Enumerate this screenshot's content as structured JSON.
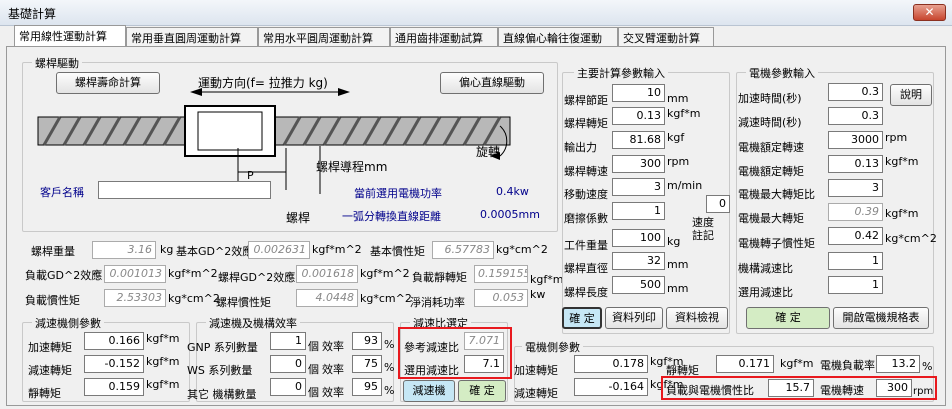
{
  "window": {
    "title": "基礎計算",
    "close": "✕"
  },
  "tabs": [
    "常用線性運動計算",
    "常用垂直圓周運動計算",
    "常用水平圓周運動計算",
    "通用齒排運動試算",
    "直線偏心輪往復運動",
    "交叉臂運動計算"
  ],
  "screw": {
    "group": "螺桿驅動",
    "life_btn": "螺桿壽命計算",
    "eccentric_btn": "偏心直線驅動",
    "direction": "運動方向(f=  拉推力 kg)",
    "pitch_lbl": "螺桿導程mm",
    "p": "P",
    "screw_lbl": "螺桿",
    "rotate_lbl": "旋轉",
    "customer_lbl": "客戶名稱",
    "motor_power_lbl": "當前選用電機功率",
    "motor_power_val": "0.4kw",
    "one_rev_lbl": "一弧分轉換直線距離",
    "one_rev_val": "0.0005mm"
  },
  "props": [
    {
      "l": "螺桿重量",
      "v": "3.16",
      "u": "kg"
    },
    {
      "l": "基本GD^2效應",
      "v": "0.002631",
      "u": "kgf*m^2"
    },
    {
      "l": "基本慣性矩",
      "v": "6.57783",
      "u": "kg*cm^2"
    },
    {
      "l": "負載GD^2效應",
      "v": "0.001013",
      "u": "kgf*m^2"
    },
    {
      "l": "螺桿GD^2效應",
      "v": "0.001618",
      "u": "kgf*m^2"
    },
    {
      "l": "負載靜轉矩",
      "v": "0.159155",
      "u": "kgf*m"
    },
    {
      "l": "負載慣性矩",
      "v": "2.53303",
      "u": "kg*cm^2"
    },
    {
      "l": "螺桿慣性矩",
      "v": "4.0448",
      "u": "kg*cm^2"
    },
    {
      "l": "淨消耗功率",
      "v": "0.053",
      "u": "kw"
    }
  ],
  "main": {
    "group": "主要計算參數輸入",
    "rows": [
      {
        "l": "螺桿節距",
        "v": "10",
        "u": "mm"
      },
      {
        "l": "螺桿轉矩",
        "v": "0.13",
        "u": "kgf*m"
      },
      {
        "l": "輸出力",
        "v": "81.68",
        "u": "kgf"
      },
      {
        "l": "螺桿轉速",
        "v": "300",
        "u": "rpm"
      },
      {
        "l": "移動速度",
        "v": "3",
        "u": "m/min"
      },
      {
        "l": "磨擦係數",
        "v": "1",
        "u": ""
      },
      {
        "l": "工件重量",
        "v": "100",
        "u": "kg"
      },
      {
        "l": "螺桿直徑",
        "v": "32",
        "u": "mm"
      },
      {
        "l": "螺桿長度",
        "v": "500",
        "u": "mm"
      }
    ],
    "speed_v": "0",
    "speed_lbl": "速度註記",
    "confirm": "確 定",
    "print": "資料列印",
    "check": "資料檢視"
  },
  "motor": {
    "group": "電機參數輸入",
    "rows": [
      {
        "l": "加速時間(秒)",
        "v": "0.3",
        "u": ""
      },
      {
        "l": "減速時間(秒)",
        "v": "0.3",
        "u": ""
      },
      {
        "l": "電機額定轉速",
        "v": "3000",
        "u": "rpm"
      },
      {
        "l": "電機額定轉矩",
        "v": "0.13",
        "u": "kgf*m"
      },
      {
        "l": "電機最大轉矩比",
        "v": "3",
        "u": ""
      },
      {
        "l": "電機最大轉矩",
        "v": "0.39",
        "u": "kgf*m"
      },
      {
        "l": "電機轉子慣性矩",
        "v": "0.42",
        "u": "kg*cm^2"
      },
      {
        "l": "機構減速比",
        "v": "1",
        "u": ""
      },
      {
        "l": "選用減速比",
        "v": "1",
        "u": ""
      }
    ],
    "explain": "說明",
    "confirm": "確 定",
    "open": "開啟電機規格表"
  },
  "reducer_side": {
    "group": "減速機側參數",
    "rows": [
      {
        "l": "加速轉矩",
        "v": "0.166",
        "u": "kgf*m"
      },
      {
        "l": "減速轉矩",
        "v": "-0.152",
        "u": "kgf*m"
      },
      {
        "l": "靜轉矩",
        "v": "0.159",
        "u": "kgf*m"
      }
    ]
  },
  "eff": {
    "group": "減速機及機構效率",
    "rows": [
      {
        "l": "GNP 系列數量",
        "v": "1",
        "u": "個",
        "e": "93"
      },
      {
        "l": "WS 系列數量",
        "v": "0",
        "u": "個",
        "e": "75"
      },
      {
        "l": "其它 機構數量",
        "v": "0",
        "u": "個",
        "e": "95"
      }
    ],
    "eff_lbl": "效率",
    "pct": "%"
  },
  "ratio": {
    "group": "減速比選定",
    "ref_lbl": "參考減速比",
    "ref_v": "7.071",
    "sel_lbl": "選用減速比",
    "sel_v": "7.1",
    "reducer_btn": "減速機",
    "confirm": "確 定"
  },
  "motor_side": {
    "group": "電機側參數",
    "acc_lbl": "加速轉矩",
    "acc_v": "0.178",
    "acc_u": "kgf*m",
    "static_lbl": "靜轉矩",
    "static_v": "0.171",
    "static_u": "kgf*m",
    "load_rate_lbl": "電機負載率",
    "load_rate_v": "13.2",
    "pct": "%",
    "dec_lbl": "減速轉矩",
    "dec_v": "-0.164",
    "dec_u": "kgf*m",
    "inertia_lbl": "負載與電機慣性比",
    "inertia_v": "15.7",
    "speed_lbl": "電機轉速",
    "speed_v": "300",
    "speed_u": "rpm"
  }
}
